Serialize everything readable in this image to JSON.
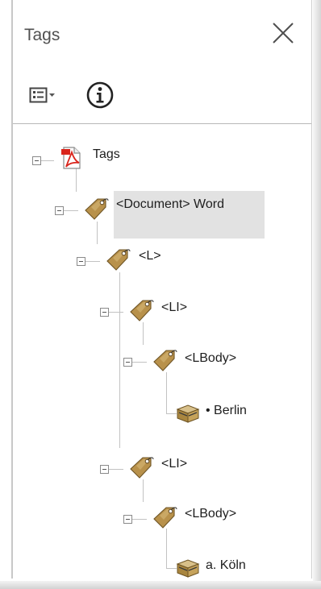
{
  "panel": {
    "title": "Tags",
    "close_icon": "close-icon",
    "options_icon": "options-menu-icon",
    "info_icon": "info-icon"
  },
  "tree": {
    "root": "Tags",
    "document": "<Document> Word",
    "list": "<L>",
    "list_item_1": "<LI>",
    "lbody_1": "<LBody>",
    "content_1": "• Berlin",
    "list_item_2": "<LI>",
    "lbody_2": "<LBody>",
    "content_2": "a. Köln"
  },
  "colors": {
    "tag_icon": "#b8914b",
    "pdf_icon": "#d9251c",
    "selection": "#e2e2e2"
  }
}
